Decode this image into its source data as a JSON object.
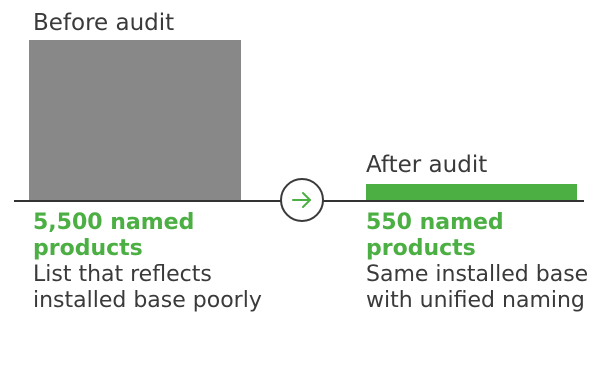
{
  "colors": {
    "before_bar": "#888888",
    "after_bar": "#4caf43",
    "highlight_text": "#4caf43",
    "line": "#333333"
  },
  "before": {
    "label": "Before audit",
    "count_text": "5,500 named products",
    "description": "List that reflects installed base poorly",
    "value": 5500
  },
  "after": {
    "label": "After audit",
    "count_text": "550 named products",
    "description": "Same installed base with unified naming",
    "value": 550
  },
  "arrow_icon": "arrow-right-icon"
}
